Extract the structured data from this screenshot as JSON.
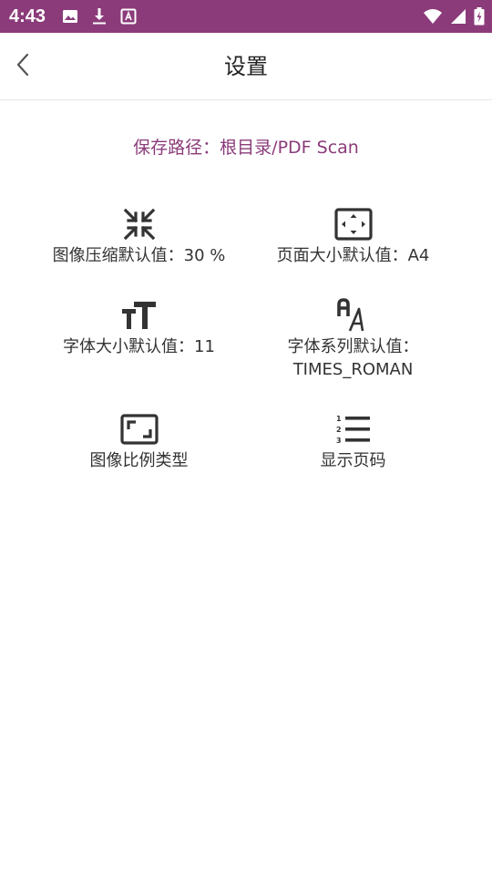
{
  "status_bar": {
    "time": "4:43",
    "color": "#8b3b7a",
    "left_icons": [
      "image-icon",
      "download-icon",
      "font-a-icon"
    ],
    "right_icons": [
      "wifi-icon",
      "signal-icon",
      "battery-charging-icon"
    ]
  },
  "app_bar": {
    "back_icon": "chevron-left-icon",
    "title": "设置"
  },
  "save_path": {
    "text": "保存路径：根目录/PDF Scan",
    "color": "#8b3b7a"
  },
  "settings": [
    {
      "id": "image-compression",
      "icon": "compress-arrows-icon",
      "label": "图像压缩默认值：30 %"
    },
    {
      "id": "page-size",
      "icon": "fullscreen-frame-icon",
      "label": "页面大小默认值：A4"
    },
    {
      "id": "font-size",
      "icon": "text-size-icon",
      "label": "字体大小默认值：11"
    },
    {
      "id": "font-family",
      "icon": "font-family-icon",
      "label": "字体系列默认值：\nTIMES_ROMAN"
    },
    {
      "id": "image-aspect",
      "icon": "aspect-ratio-icon",
      "label": "图像比例类型"
    },
    {
      "id": "show-page-number",
      "icon": "numbered-list-icon",
      "label": "显示页码"
    }
  ]
}
